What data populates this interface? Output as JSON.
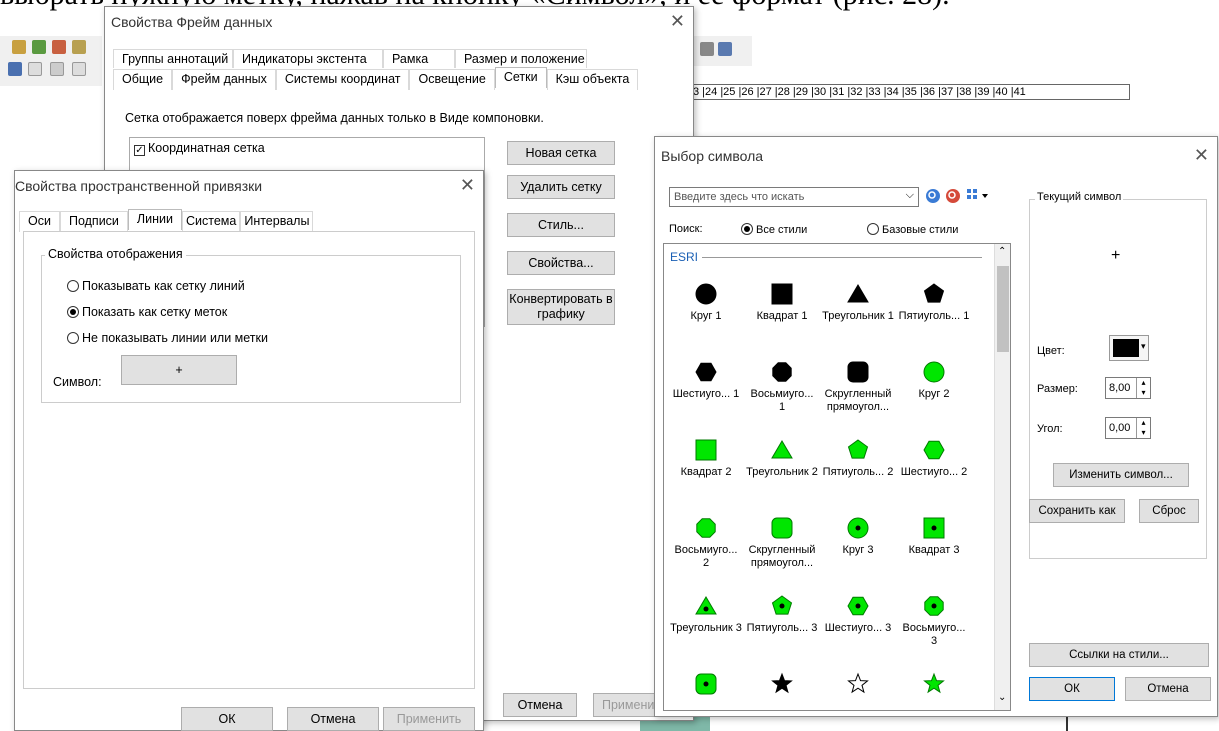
{
  "document_text": "выбрать нужную метку, нажав на кнопку «Символ», и ее формат (рис. 28).",
  "ruler": {
    "ticks": "3 |24 |25 |26 |27 |28 |29 |30 |31 |32 |33 |34 |35 |36 |37 |38 |39 |40 |41"
  },
  "frame_dialog": {
    "title": "Свойства Фрейм данных",
    "tabs_row1": [
      "Группы аннотаций",
      "Индикаторы экстента",
      "Рамка",
      "Размер и положение"
    ],
    "tabs_row2": [
      "Общие",
      "Фрейм данных",
      "Системы координат",
      "Освещение",
      "Сетки",
      "Кэш объекта"
    ],
    "active_tab": "Сетки",
    "info": "Сетка отображается поверх фрейма данных только в Виде компоновки.",
    "grid_item": "Координатная сетка",
    "buttons": {
      "new": "Новая сетка",
      "delete": "Удалить сетку",
      "style": "Стиль...",
      "props": "Свойства...",
      "convert": "Конвертировать в графику"
    },
    "cancel": "Отмена",
    "apply": "Применить"
  },
  "ref_dialog": {
    "title": "Свойства пространственной привязки",
    "tabs": [
      "Оси",
      "Подписи",
      "Линии",
      "Система",
      "Интервалы"
    ],
    "active_tab": "Линии",
    "group_title": "Свойства отображения",
    "options": [
      "Показывать как сетку линий",
      "Показать как сетку меток",
      "Не показывать линии или метки"
    ],
    "selected_option": 1,
    "symbol_label": "Символ:",
    "symbol_value": "+",
    "ok": "ОК",
    "cancel": "Отмена",
    "apply": "Применить"
  },
  "symbol_dialog": {
    "title": "Выбор символа",
    "search_placeholder": "Введите здесь что искать",
    "search_label": "Поиск:",
    "scope_all": "Все стили",
    "scope_base": "Базовые стили",
    "group": "ESRI",
    "symbols": [
      {
        "label": "Круг 1",
        "shape": "circle",
        "fill": "#000000"
      },
      {
        "label": "Квадрат 1",
        "shape": "square",
        "fill": "#000000"
      },
      {
        "label": "Треугольник 1",
        "shape": "triangle",
        "fill": "#000000"
      },
      {
        "label": "Пятиуголь... 1",
        "shape": "pentagon",
        "fill": "#000000"
      },
      {
        "label": "Шестиуго... 1",
        "shape": "hexagon",
        "fill": "#000000"
      },
      {
        "label": "Восьмиуго... 1",
        "shape": "octagon",
        "fill": "#000000"
      },
      {
        "label": "Скругленный прямоугол...",
        "shape": "rounded",
        "fill": "#000000"
      },
      {
        "label": "Круг 2",
        "shape": "circle",
        "fill": "#00e600"
      },
      {
        "label": "Квадрат 2",
        "shape": "square",
        "fill": "#00e600"
      },
      {
        "label": "Треугольник 2",
        "shape": "triangle",
        "fill": "#00e600"
      },
      {
        "label": "Пятиуголь... 2",
        "shape": "pentagon",
        "fill": "#00e600"
      },
      {
        "label": "Шестиуго... 2",
        "shape": "hexagon",
        "fill": "#00e600"
      },
      {
        "label": "Восьмиуго... 2",
        "shape": "octagon",
        "fill": "#00e600"
      },
      {
        "label": "Скругленный прямоугол...",
        "shape": "rounded",
        "fill": "#00e600"
      },
      {
        "label": "Круг 3",
        "shape": "circle-dot",
        "fill": "#00e600"
      },
      {
        "label": "Квадрат 3",
        "shape": "square-dot",
        "fill": "#00e600"
      },
      {
        "label": "Треугольник 3",
        "shape": "triangle-dot",
        "fill": "#00e600"
      },
      {
        "label": "Пятиуголь... 3",
        "shape": "pentagon-dot",
        "fill": "#00e600"
      },
      {
        "label": "Шестиуго... 3",
        "shape": "hexagon-dot",
        "fill": "#00e600"
      },
      {
        "label": "Восьмиуго... 3",
        "shape": "octagon-dot",
        "fill": "#00e600"
      },
      {
        "label": "",
        "shape": "rounded-dot",
        "fill": "#00e600"
      },
      {
        "label": "",
        "shape": "star",
        "fill": "#000000"
      },
      {
        "label": "",
        "shape": "star-outline",
        "fill": "#ffffff"
      },
      {
        "label": "",
        "shape": "star",
        "fill": "#00e600"
      }
    ],
    "current_symbol_title": "Текущий символ",
    "current_symbol": "+",
    "color_label": "Цвет:",
    "color_value": "#000000",
    "size_label": "Размер:",
    "size_value": "8,00",
    "angle_label": "Угол:",
    "angle_value": "0,00",
    "edit_symbol": "Изменить символ...",
    "save_as": "Сохранить как",
    "reset": "Сброс",
    "style_refs": "Ссылки на стили...",
    "ok": "ОК",
    "cancel": "Отмена"
  }
}
